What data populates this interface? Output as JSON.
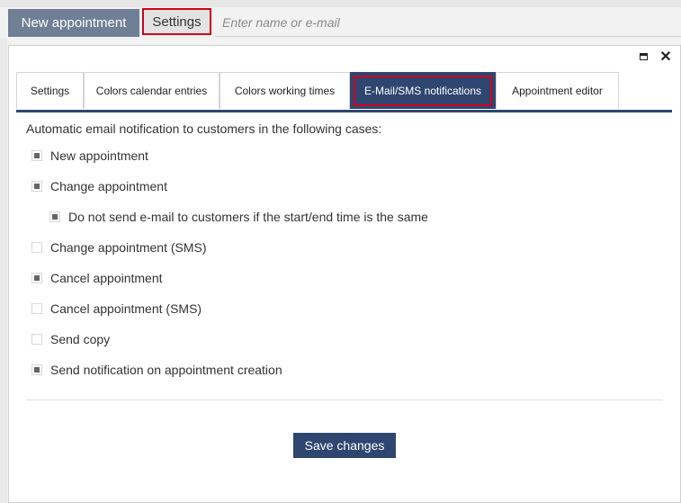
{
  "toolbar": {
    "new_appointment_label": "New appointment",
    "settings_label": "Settings",
    "search_placeholder": "Enter name or e-mail"
  },
  "dialog": {
    "window_controls": {
      "maximize_icon": "maximize-icon",
      "close_symbol": "✕"
    },
    "tabs": [
      {
        "label": "Settings",
        "active": false
      },
      {
        "label": "Colors calendar entries",
        "active": false
      },
      {
        "label": "Colors working times",
        "active": false
      },
      {
        "label": "E-Mail/SMS notifications",
        "active": true
      },
      {
        "label": "Appointment editor",
        "active": false
      }
    ],
    "heading": "Automatic email notification to customers in the following cases:",
    "options": [
      {
        "label": "New appointment",
        "checked": true
      },
      {
        "label": "Change appointment",
        "checked": true
      },
      {
        "label": "Do not send e-mail to customers if the start/end time is the same",
        "checked": true
      },
      {
        "label": "Change appointment (SMS)",
        "checked": false
      },
      {
        "label": "Cancel appointment",
        "checked": true
      },
      {
        "label": "Cancel appointment (SMS)",
        "checked": false
      },
      {
        "label": "Send copy",
        "checked": false
      },
      {
        "label": "Send notification on appointment creation",
        "checked": true
      }
    ],
    "save_label": "Save changes"
  },
  "colors": {
    "primary": "#2e4670",
    "highlight": "#d0021b",
    "new_button": "#6f7f96"
  }
}
